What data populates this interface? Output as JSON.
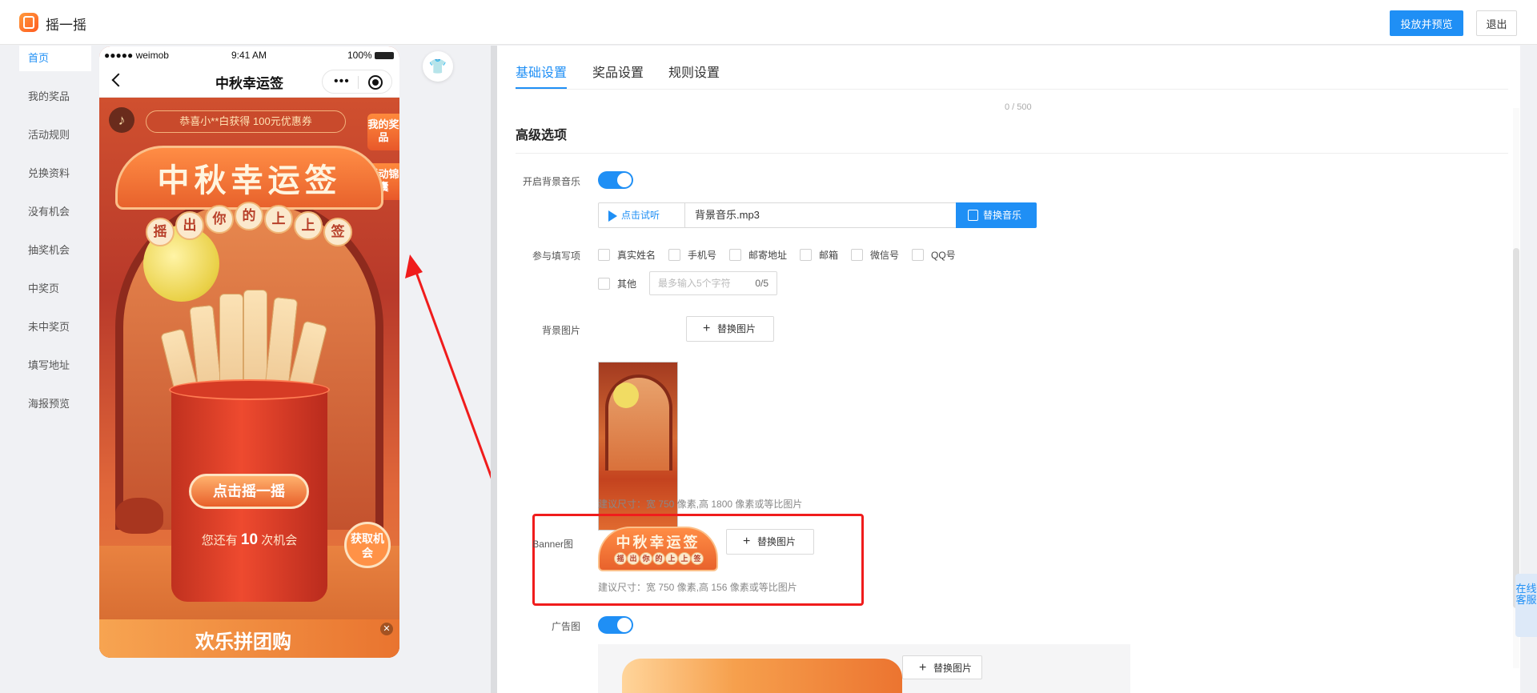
{
  "header": {
    "app_title": "摇一摇",
    "publish_label": "投放并预览",
    "exit_label": "退出"
  },
  "sidebar": {
    "items": [
      {
        "label": "首页",
        "active": true
      },
      {
        "label": "我的奖品"
      },
      {
        "label": "活动规则"
      },
      {
        "label": "兑换资料"
      },
      {
        "label": "没有机会"
      },
      {
        "label": "抽奖机会"
      },
      {
        "label": "中奖页"
      },
      {
        "label": "未中奖页"
      },
      {
        "label": "填写地址"
      },
      {
        "label": "海报预览"
      }
    ]
  },
  "phone": {
    "status": {
      "carrier": "●●●●● weimob",
      "time": "9:41 AM",
      "battery": "100%"
    },
    "nav_title": "中秋幸运签",
    "marquee": "恭喜小**白获得 100元优惠券",
    "tag_prizes": "我的奖品",
    "tag_rules": "活动锦囊",
    "banner_title": "中秋幸运签",
    "banner_coins": [
      "摇",
      "出",
      "你",
      "的",
      "上",
      "上",
      "签"
    ],
    "shake_button": "点击摇一摇",
    "chance_prefix": "您还有",
    "chance_count": "10",
    "chance_suffix": "次机会",
    "get_chance": "获取机会",
    "bottom_banner": "欢乐拼团购"
  },
  "panel": {
    "tabs": [
      {
        "label": "基础设置",
        "active": true
      },
      {
        "label": "奖品设置"
      },
      {
        "label": "规则设置"
      }
    ],
    "top_counter": "0 / 500",
    "section_title": "高级选项",
    "bg_music": {
      "label": "开启背景音乐",
      "enabled": true,
      "listen_label": "点击试听",
      "file_name": "背景音乐.mp3",
      "replace_label": "替换音乐"
    },
    "fields": {
      "label": "参与填写项",
      "options": [
        "真实姓名",
        "手机号",
        "邮寄地址",
        "邮箱",
        "微信号",
        "QQ号",
        "其他"
      ],
      "other_placeholder": "最多输入5个字符",
      "other_count": "0/5"
    },
    "bg_image": {
      "label": "背景图片",
      "replace_label": "替换图片",
      "hint": "建议尺寸：宽 750 像素,高 1800 像素或等比图片"
    },
    "banner": {
      "label": "Banner图",
      "replace_label": "替换图片",
      "hint": "建议尺寸：宽 750 像素,高 156 像素或等比图片",
      "thumb_title": "中秋幸运签"
    },
    "ad": {
      "label": "广告图",
      "enabled": true,
      "replace_label": "替换图片"
    }
  },
  "service_tab": "在线客服",
  "colors": {
    "primary": "#1f8ff5",
    "highlight": "#f01c1c"
  }
}
